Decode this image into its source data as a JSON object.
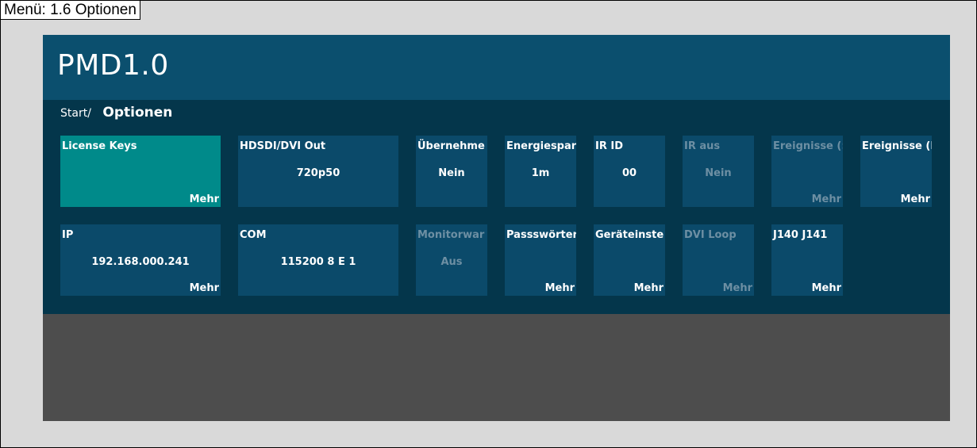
{
  "caption": "Menü: 1.6 Optionen",
  "app": {
    "title": "PMD1.0"
  },
  "breadcrumb": {
    "start": "Start/",
    "current": "Optionen"
  },
  "row1": [
    {
      "label": "License Keys",
      "value": "",
      "more": "Mehr"
    },
    {
      "label": "HDSDI/DVI Out",
      "value": "720p50",
      "more": ""
    },
    {
      "label": "Übernehme",
      "value": "Nein",
      "more": ""
    },
    {
      "label": "Energiespar",
      "value": "1m",
      "more": ""
    },
    {
      "label": "IR ID",
      "value": "00",
      "more": ""
    },
    {
      "label": "IR aus",
      "value": "Nein",
      "more": ""
    },
    {
      "label": "Ereignisse (:",
      "value": "",
      "more": "Mehr"
    },
    {
      "label": "Ereignisse (I",
      "value": "",
      "more": "Mehr"
    }
  ],
  "row2": [
    {
      "label": "IP",
      "value": "192.168.000.241",
      "more": "Mehr"
    },
    {
      "label": "COM",
      "value": "115200 8 E 1",
      "more": ""
    },
    {
      "label": "Monitorwar",
      "value": "Aus",
      "more": ""
    },
    {
      "label": "Passswörter",
      "value": "",
      "more": "Mehr"
    },
    {
      "label": "Geräteinste",
      "value": "",
      "more": "Mehr"
    },
    {
      "label": "DVI Loop",
      "value": "",
      "more": "Mehr"
    },
    {
      "label": "J140 J141",
      "value": "",
      "more": "Mehr"
    }
  ],
  "colors": {
    "titlebar": "#0b4f6e",
    "content": "#04364b",
    "tile": "#0b4a6a",
    "tile_active": "#008a8a",
    "tile_disabled_text": "#6d8fa3",
    "bottom": "#4d4d4d"
  }
}
